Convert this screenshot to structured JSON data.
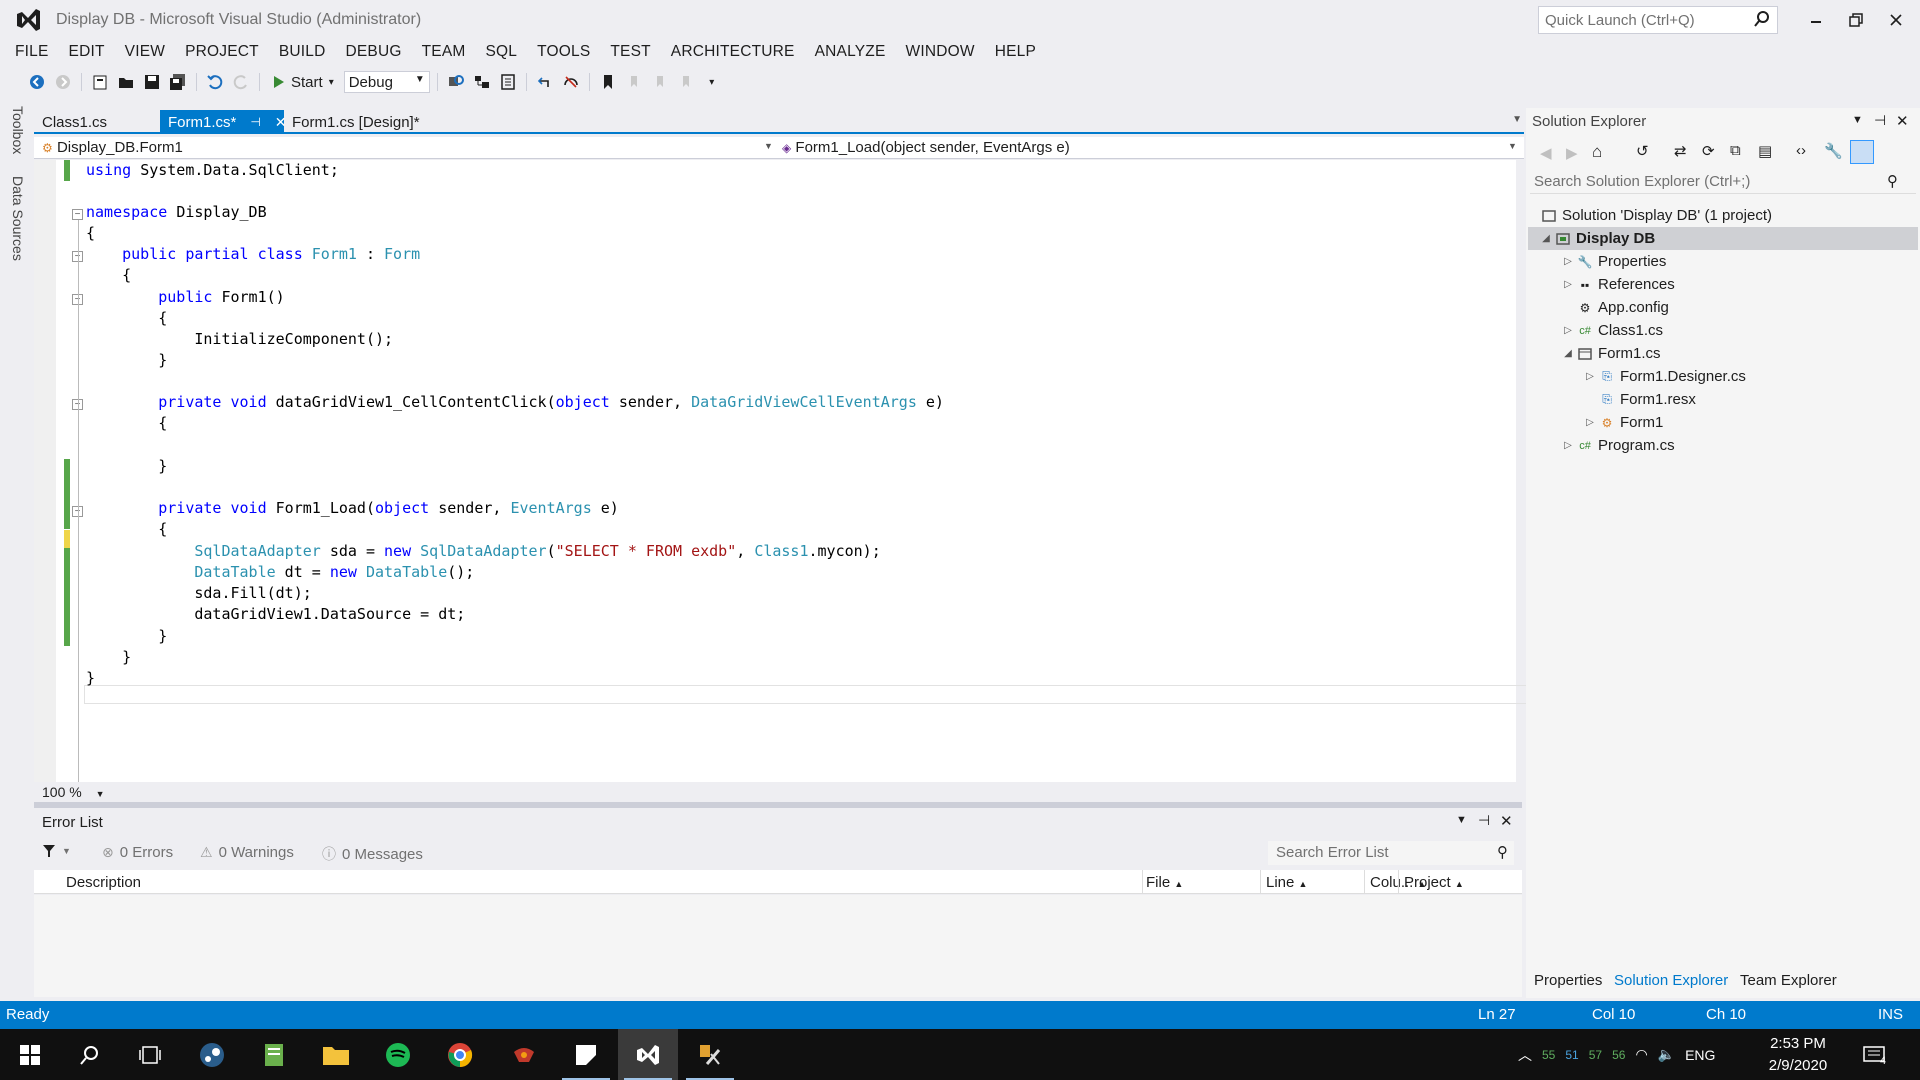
{
  "window": {
    "title": "Display DB - Microsoft Visual Studio (Administrator)",
    "quick_launch_placeholder": "Quick Launch (Ctrl+Q)"
  },
  "menu": [
    "FILE",
    "EDIT",
    "VIEW",
    "PROJECT",
    "BUILD",
    "DEBUG",
    "TEAM",
    "SQL",
    "TOOLS",
    "TEST",
    "ARCHITECTURE",
    "ANALYZE",
    "WINDOW",
    "HELP"
  ],
  "toolbar": {
    "start_label": "Start",
    "config_value": "Debug"
  },
  "side_tabs": [
    "Toolbox",
    "Data Sources"
  ],
  "editor": {
    "tabs": [
      {
        "label": "Class1.cs",
        "active": false
      },
      {
        "label": "Form1.cs*",
        "active": true
      },
      {
        "label": "Form1.cs [Design]*",
        "active": false
      }
    ],
    "nav_class": "Display_DB.Form1",
    "nav_member": "Form1_Load(object sender, EventArgs e)",
    "zoom": "100 %",
    "code_lines": [
      "using System.Data.SqlClient;",
      "",
      "namespace Display_DB",
      "{",
      "    public partial class Form1 : Form",
      "    {",
      "        public Form1()",
      "        {",
      "            InitializeComponent();",
      "        }",
      "",
      "        private void dataGridView1_CellContentClick(object sender, DataGridViewCellEventArgs e)",
      "        {",
      "",
      "        }",
      "",
      "        private void Form1_Load(object sender, EventArgs e)",
      "        {",
      "            SqlDataAdapter sda = new SqlDataAdapter(\"SELECT * FROM exdb\", Class1.mycon);",
      "            DataTable dt = new DataTable();",
      "            sda.Fill(dt);",
      "            dataGridView1.DataSource = dt;",
      "        }",
      "    }",
      "}"
    ]
  },
  "error_list": {
    "title": "Error List",
    "errors": "0 Errors",
    "warnings": "0 Warnings",
    "messages": "0 Messages",
    "search_placeholder": "Search Error List",
    "columns": [
      "Description",
      "File",
      "Line",
      "Colu...",
      "Project"
    ]
  },
  "solution_explorer": {
    "title": "Solution Explorer",
    "search_placeholder": "Search Solution Explorer (Ctrl+;)",
    "items": [
      {
        "label": "Solution 'Display DB' (1 project)",
        "level": 0,
        "expander": "",
        "icon": "solution-icon",
        "bold": false
      },
      {
        "label": "Display DB",
        "level": 0,
        "expander": "open",
        "icon": "csharp-project-icon",
        "bold": true,
        "selected": true
      },
      {
        "label": "Properties",
        "level": 1,
        "expander": "closed",
        "icon": "wrench-icon"
      },
      {
        "label": "References",
        "level": 1,
        "expander": "closed",
        "icon": "references-icon"
      },
      {
        "label": "App.config",
        "level": 1,
        "expander": "",
        "icon": "config-icon"
      },
      {
        "label": "Class1.cs",
        "level": 1,
        "expander": "closed",
        "icon": "csharp-file-icon"
      },
      {
        "label": "Form1.cs",
        "level": 1,
        "expander": "open",
        "icon": "form-icon"
      },
      {
        "label": "Form1.Designer.cs",
        "level": 2,
        "expander": "closed",
        "icon": "designer-file-icon"
      },
      {
        "label": "Form1.resx",
        "level": 2,
        "expander": "",
        "icon": "resx-icon"
      },
      {
        "label": "Form1",
        "level": 2,
        "expander": "closed",
        "icon": "class-icon"
      },
      {
        "label": "Program.cs",
        "level": 1,
        "expander": "closed",
        "icon": "csharp-file-icon"
      }
    ],
    "bottom_tabs": [
      "Properties",
      "Solution Explorer",
      "Team Explorer"
    ]
  },
  "status": {
    "state": "Ready",
    "line": "Ln 27",
    "col": "Col 10",
    "ch": "Ch 10",
    "mode": "INS"
  },
  "taskbar": {
    "tray_numbers": [
      "55",
      "51",
      "57",
      "56"
    ],
    "language": "ENG",
    "time": "2:53 PM",
    "date": "2/9/2020",
    "notifications": "4"
  },
  "colors": {
    "accent": "#007acc",
    "keyword": "#0000ff",
    "type": "#2b91af",
    "string": "#a31515",
    "change_bar": "#57a64a"
  }
}
